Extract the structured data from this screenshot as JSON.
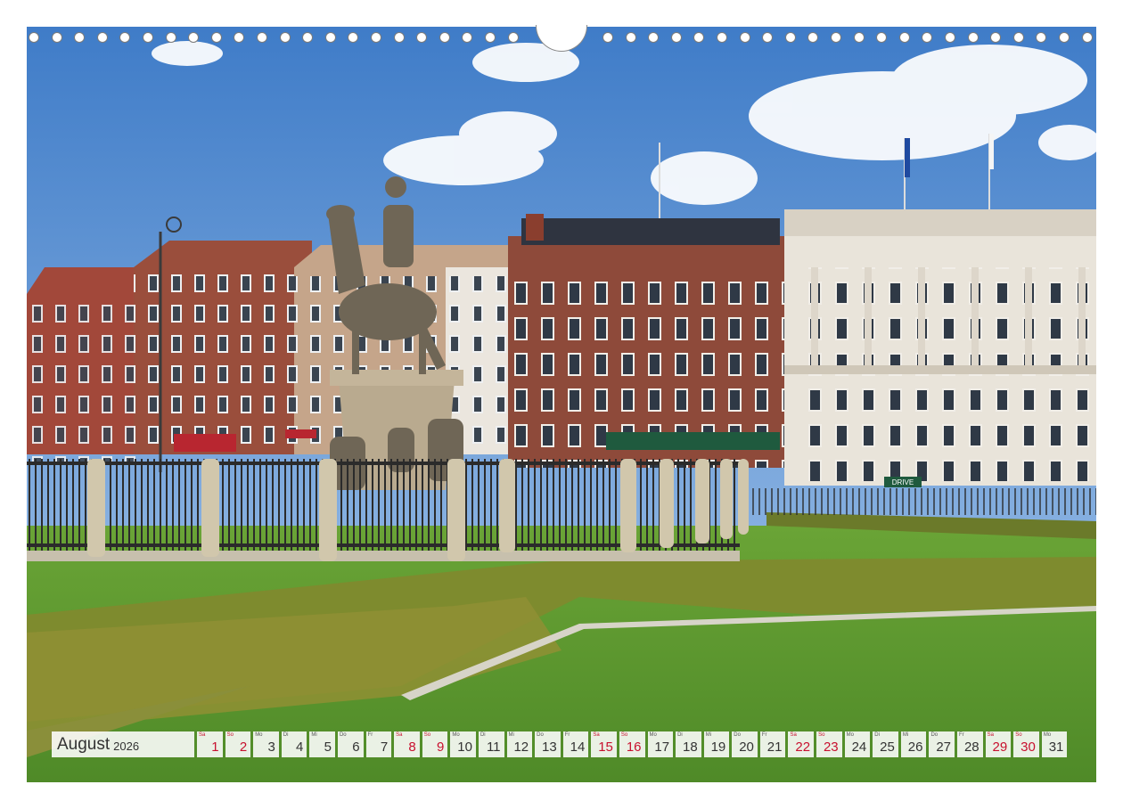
{
  "calendar": {
    "month": "August",
    "year": "2026",
    "days": [
      {
        "wd": "Sa",
        "num": "1",
        "weekend": true
      },
      {
        "wd": "So",
        "num": "2",
        "weekend": true
      },
      {
        "wd": "Mo",
        "num": "3",
        "weekend": false
      },
      {
        "wd": "Di",
        "num": "4",
        "weekend": false
      },
      {
        "wd": "Mi",
        "num": "5",
        "weekend": false
      },
      {
        "wd": "Do",
        "num": "6",
        "weekend": false
      },
      {
        "wd": "Fr",
        "num": "7",
        "weekend": false
      },
      {
        "wd": "Sa",
        "num": "8",
        "weekend": true
      },
      {
        "wd": "So",
        "num": "9",
        "weekend": true
      },
      {
        "wd": "Mo",
        "num": "10",
        "weekend": false
      },
      {
        "wd": "Di",
        "num": "11",
        "weekend": false
      },
      {
        "wd": "Mi",
        "num": "12",
        "weekend": false
      },
      {
        "wd": "Do",
        "num": "13",
        "weekend": false
      },
      {
        "wd": "Fr",
        "num": "14",
        "weekend": false
      },
      {
        "wd": "Sa",
        "num": "15",
        "weekend": true
      },
      {
        "wd": "So",
        "num": "16",
        "weekend": true
      },
      {
        "wd": "Mo",
        "num": "17",
        "weekend": false
      },
      {
        "wd": "Di",
        "num": "18",
        "weekend": false
      },
      {
        "wd": "Mi",
        "num": "19",
        "weekend": false
      },
      {
        "wd": "Do",
        "num": "20",
        "weekend": false
      },
      {
        "wd": "Fr",
        "num": "21",
        "weekend": false
      },
      {
        "wd": "Sa",
        "num": "22",
        "weekend": true
      },
      {
        "wd": "So",
        "num": "23",
        "weekend": true
      },
      {
        "wd": "Mo",
        "num": "24",
        "weekend": false
      },
      {
        "wd": "Di",
        "num": "25",
        "weekend": false
      },
      {
        "wd": "Mi",
        "num": "26",
        "weekend": false
      },
      {
        "wd": "Do",
        "num": "27",
        "weekend": false
      },
      {
        "wd": "Fr",
        "num": "28",
        "weekend": false
      },
      {
        "wd": "Sa",
        "num": "29",
        "weekend": true
      },
      {
        "wd": "So",
        "num": "30",
        "weekend": true
      },
      {
        "wd": "Mo",
        "num": "31",
        "weekend": false
      }
    ]
  },
  "colors": {
    "weekend": "#c8102e",
    "sky": "#5b8fd0",
    "lawn": "#5f9a32",
    "brick": "#8e4a3a"
  },
  "photo": {
    "shop_sign": "DRIVE"
  }
}
